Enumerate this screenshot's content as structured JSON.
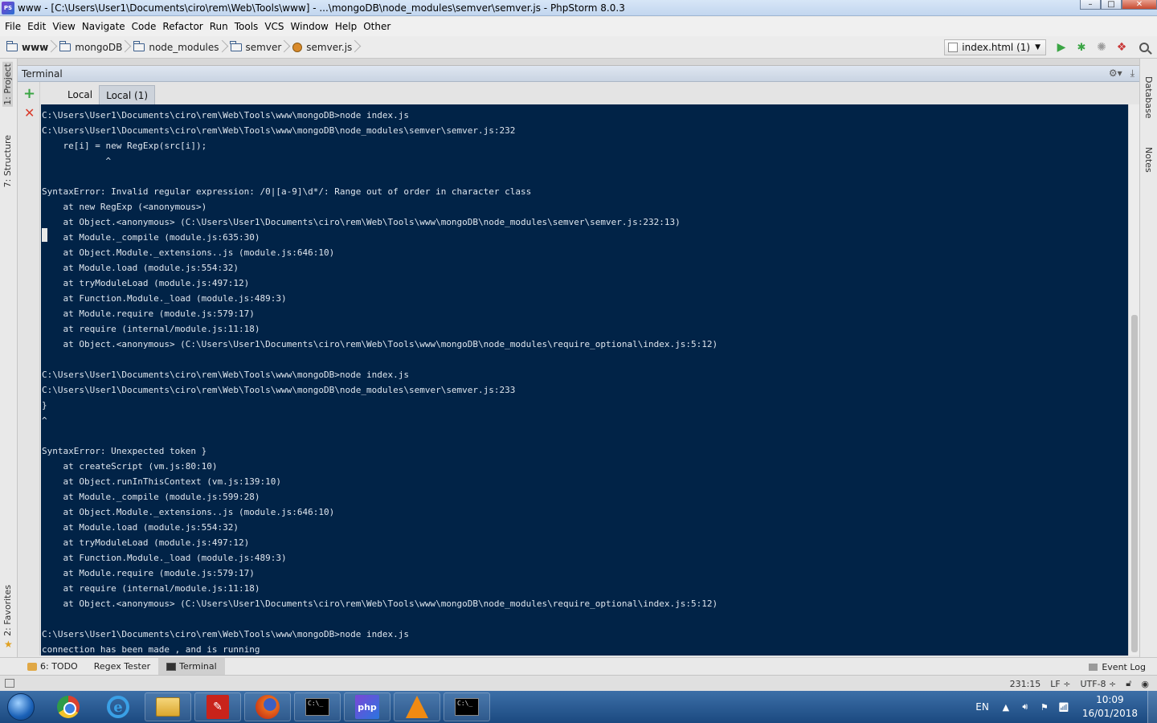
{
  "window": {
    "title": "www - [C:\\Users\\User1\\Documents\\ciro\\rem\\Web\\Tools\\www] - ...\\mongoDB\\node_modules\\semver\\semver.js - PhpStorm 8.0.3",
    "app_icon_text": "PS"
  },
  "menu": [
    "File",
    "Edit",
    "View",
    "Navigate",
    "Code",
    "Refactor",
    "Run",
    "Tools",
    "VCS",
    "Window",
    "Help",
    "Other"
  ],
  "breadcrumb": [
    "www",
    "mongoDB",
    "node_modules",
    "semver",
    "semver.js"
  ],
  "toolbar": {
    "run_config": "index.html (1)",
    "run_icon": "play-icon",
    "debug_icon": "bug-icon",
    "coverage_icon": "coverage-icon",
    "profile_icon": "profile-icon",
    "search_icon": "search-icon"
  },
  "left_stripe": [
    "1: Project",
    "7: Structure",
    "2: Favorites"
  ],
  "right_stripe": [
    "Database",
    "Notes"
  ],
  "terminal": {
    "header": "Terminal",
    "tabs": [
      "Local",
      "Local (1)"
    ],
    "active_tab": 1,
    "lines": [
      "C:\\Users\\User1\\Documents\\ciro\\rem\\Web\\Tools\\www\\mongoDB>node index.js",
      "C:\\Users\\User1\\Documents\\ciro\\rem\\Web\\Tools\\www\\mongoDB\\node_modules\\semver\\semver.js:232",
      "    re[i] = new RegExp(src[i]);",
      "            ^",
      "",
      "SyntaxError: Invalid regular expression: /0|[a-9]\\d*/: Range out of order in character class",
      "    at new RegExp (<anonymous>)",
      "    at Object.<anonymous> (C:\\Users\\User1\\Documents\\ciro\\rem\\Web\\Tools\\www\\mongoDB\\node_modules\\semver\\semver.js:232:13)",
      "    at Module._compile (module.js:635:30)",
      "    at Object.Module._extensions..js (module.js:646:10)",
      "    at Module.load (module.js:554:32)",
      "    at tryModuleLoad (module.js:497:12)",
      "    at Function.Module._load (module.js:489:3)",
      "    at Module.require (module.js:579:17)",
      "    at require (internal/module.js:11:18)",
      "    at Object.<anonymous> (C:\\Users\\User1\\Documents\\ciro\\rem\\Web\\Tools\\www\\mongoDB\\node_modules\\require_optional\\index.js:5:12)",
      "",
      "C:\\Users\\User1\\Documents\\ciro\\rem\\Web\\Tools\\www\\mongoDB>node index.js",
      "C:\\Users\\User1\\Documents\\ciro\\rem\\Web\\Tools\\www\\mongoDB\\node_modules\\semver\\semver.js:233",
      "}",
      "^",
      "",
      "SyntaxError: Unexpected token }",
      "    at createScript (vm.js:80:10)",
      "    at Object.runInThisContext (vm.js:139:10)",
      "    at Module._compile (module.js:599:28)",
      "    at Object.Module._extensions..js (module.js:646:10)",
      "    at Module.load (module.js:554:32)",
      "    at tryModuleLoad (module.js:497:12)",
      "    at Function.Module._load (module.js:489:3)",
      "    at Module.require (module.js:579:17)",
      "    at require (internal/module.js:11:18)",
      "    at Object.<anonymous> (C:\\Users\\User1\\Documents\\ciro\\rem\\Web\\Tools\\www\\mongoDB\\node_modules\\require_optional\\index.js:5:12)",
      "",
      "C:\\Users\\User1\\Documents\\ciro\\rem\\Web\\Tools\\www\\mongoDB>node index.js",
      "connection has been made , and is running"
    ]
  },
  "bottom_tabs": [
    "6: TODO",
    "Regex Tester",
    "Terminal"
  ],
  "event_log": "Event Log",
  "status": {
    "position": "231:15",
    "line_sep": "LF ÷",
    "encoding": "UTF-8 ÷"
  },
  "taskbar": {
    "apps": [
      "chrome-icon",
      "internet-explorer-icon",
      "file-explorer-icon",
      "acrobat-icon",
      "firefox-icon",
      "cmd-icon",
      "phpstorm-icon",
      "vlc-icon",
      "cmd-icon"
    ],
    "language": "EN",
    "time": "10:09",
    "date": "16/01/2018"
  }
}
